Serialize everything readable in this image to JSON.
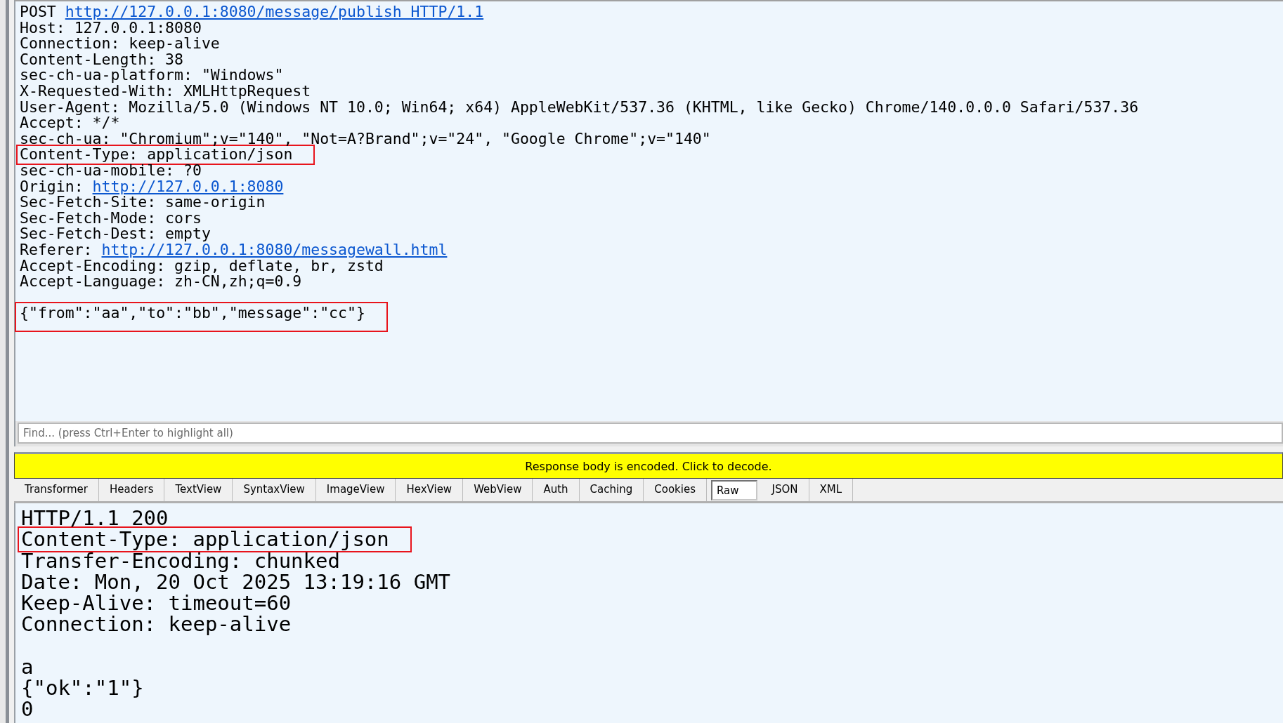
{
  "request": {
    "lines": [
      {
        "text": "POST ",
        "link": "http://127.0.0.1:8080/message/publish HTTP/1.1",
        "highlighted": false
      },
      {
        "text": "Host: 127.0.0.1:8080",
        "highlighted": false
      },
      {
        "text": "Connection: keep-alive",
        "highlighted": false
      },
      {
        "text": "Content-Length: 38",
        "highlighted": false
      },
      {
        "text": "sec-ch-ua-platform: \"Windows\"",
        "highlighted": false
      },
      {
        "text": "X-Requested-With: XMLHttpRequest",
        "highlighted": false
      },
      {
        "text": "User-Agent: Mozilla/5.0 (Windows NT 10.0; Win64; x64) AppleWebKit/537.36 (KHTML, like Gecko) Chrome/140.0.0.0 Safari/537.36",
        "highlighted": false
      },
      {
        "text": "Accept: */*",
        "highlighted": false
      },
      {
        "text": "sec-ch-ua: \"Chromium\";v=\"140\", \"Not=A?Brand\";v=\"24\", \"Google Chrome\";v=\"140\"",
        "highlighted": false
      },
      {
        "text": "Content-Type: application/json",
        "highlighted": true
      },
      {
        "text": "sec-ch-ua-mobile: ?0",
        "highlighted": false
      },
      {
        "text": "Origin: ",
        "link": "http://127.0.0.1:8080",
        "highlighted": false
      },
      {
        "text": "Sec-Fetch-Site: same-origin",
        "highlighted": false
      },
      {
        "text": "Sec-Fetch-Mode: cors",
        "highlighted": false
      },
      {
        "text": "Sec-Fetch-Dest: empty",
        "highlighted": false
      },
      {
        "text": "Referer: ",
        "link": "http://127.0.0.1:8080/messagewall.html",
        "highlighted": false
      },
      {
        "text": "Accept-Encoding: gzip, deflate, br, zstd",
        "highlighted": false
      },
      {
        "text": "Accept-Language: zh-CN,zh;q=0.9",
        "highlighted": false
      }
    ],
    "body": {
      "text": "{\"from\":\"aa\",\"to\":\"bb\",\"message\":\"cc\"}",
      "highlighted": true
    }
  },
  "find": {
    "placeholder": "Find... (press Ctrl+Enter to highlight all)"
  },
  "notice": "Response body is encoded. Click to decode.",
  "tabs": [
    {
      "label": "Transformer",
      "selected": false
    },
    {
      "label": "Headers",
      "selected": false
    },
    {
      "label": "TextView",
      "selected": false
    },
    {
      "label": "SyntaxView",
      "selected": false
    },
    {
      "label": "ImageView",
      "selected": false
    },
    {
      "label": "HexView",
      "selected": false
    },
    {
      "label": "WebView",
      "selected": false
    },
    {
      "label": "Auth",
      "selected": false
    },
    {
      "label": "Caching",
      "selected": false
    },
    {
      "label": "Cookies",
      "selected": false
    },
    {
      "label": "Raw",
      "selected": true
    },
    {
      "label": "JSON",
      "selected": false
    },
    {
      "label": "XML",
      "selected": false
    }
  ],
  "response": {
    "lines": [
      {
        "text": "HTTP/1.1 200",
        "highlighted": false
      },
      {
        "text": "Content-Type: application/json",
        "highlighted": true
      },
      {
        "text": "Transfer-Encoding: chunked",
        "highlighted": false
      },
      {
        "text": "Date: Mon, 20 Oct 2025 13:19:16 GMT",
        "highlighted": false
      },
      {
        "text": "Keep-Alive: timeout=60",
        "highlighted": false
      },
      {
        "text": "Connection: keep-alive",
        "highlighted": false
      }
    ],
    "body": [
      "a",
      "{\"ok\":\"1\"}",
      "0"
    ]
  }
}
